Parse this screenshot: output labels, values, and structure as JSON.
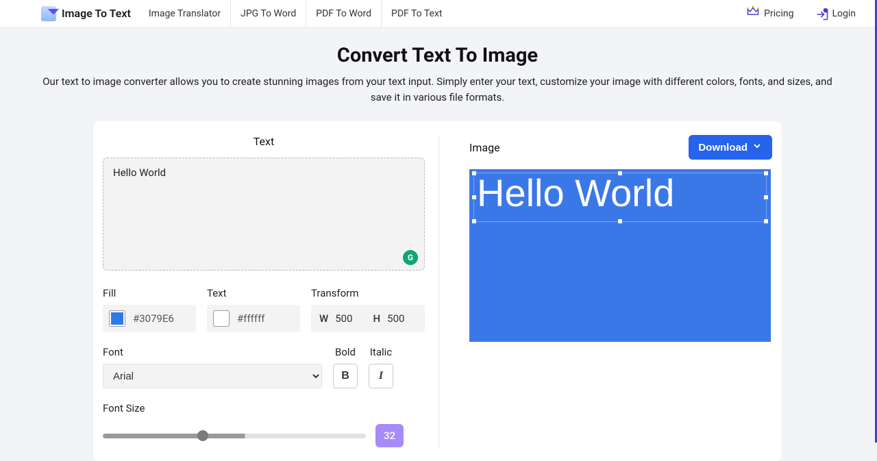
{
  "nav": {
    "logo_text": "Image To Text",
    "links": [
      "Image Translator",
      "JPG To Word",
      "PDF To Word",
      "PDF To Text"
    ],
    "pricing_label": "Pricing",
    "login_label": "Login"
  },
  "hero": {
    "title": "Convert Text To Image",
    "subtitle": "Our text to image converter allows you to create stunning images from your text input. Simply enter your text, customize your image with different colors, fonts, and sizes, and save it in various file formats."
  },
  "panel": {
    "text_header": "Text",
    "image_header": "Image",
    "download_label": "Download",
    "textarea_value": "Hello World",
    "fill_label": "Fill",
    "fill_color": "#3079E6",
    "text_label": "Text",
    "text_color": "#ffffff",
    "transform_label": "Transform",
    "transform_w_label": "W",
    "transform_w": "500",
    "transform_h_label": "H",
    "transform_h": "500",
    "font_label": "Font",
    "font_value": "Arial",
    "bold_label": "Bold",
    "bold_button": "B",
    "italic_label": "Italic",
    "italic_button": "I",
    "fontsize_label": "Font Size",
    "fontsize_value": "32"
  },
  "canvas": {
    "text": "Hello World"
  }
}
